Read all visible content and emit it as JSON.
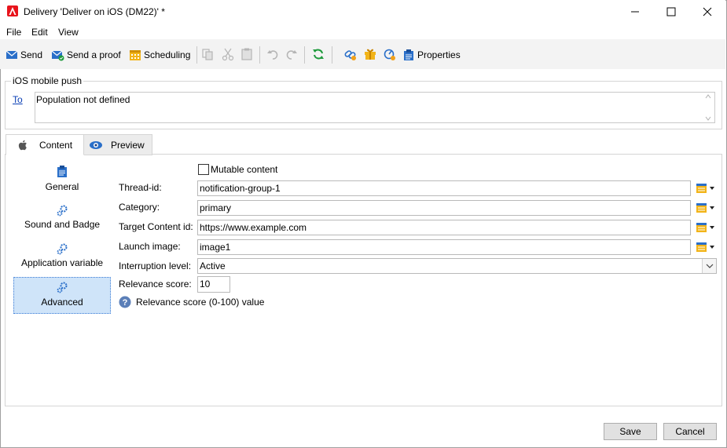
{
  "window": {
    "title": "Delivery 'Deliver on iOS (DM22)' *"
  },
  "menu": {
    "items": [
      "File",
      "Edit",
      "View"
    ]
  },
  "toolbar": {
    "send_label": "Send",
    "proof_label": "Send a proof",
    "scheduling_label": "Scheduling",
    "properties_label": "Properties"
  },
  "recipients": {
    "group_title": "iOS mobile push",
    "to_label": "To",
    "to_value": "Population not defined"
  },
  "tabs": [
    {
      "label": "Content",
      "active": true
    },
    {
      "label": "Preview",
      "active": false
    }
  ],
  "nav": {
    "items": [
      {
        "label": "General",
        "icon": "clipboard-icon",
        "selected": false
      },
      {
        "label": "Sound and Badge",
        "icon": "gears-icon",
        "selected": false
      },
      {
        "label": "Application variable",
        "icon": "gears-icon",
        "selected": false
      },
      {
        "label": "Advanced",
        "icon": "gears-icon",
        "selected": true
      }
    ]
  },
  "form": {
    "mutable_label": "Mutable content",
    "mutable_checked": false,
    "thread_label": "Thread-id:",
    "thread_value": "notification-group-1",
    "category_label": "Category:",
    "category_value": "primary",
    "target_label": "Target Content id:",
    "target_value": "https://www.example.com",
    "launch_label": "Launch image:",
    "launch_value": "image1",
    "interruption_label": "Interruption level:",
    "interruption_value": "Active",
    "relevance_label": "Relevance score:",
    "relevance_value": "10",
    "help_text": "Relevance score (0-100) value"
  },
  "footer": {
    "save_label": "Save",
    "cancel_label": "Cancel"
  },
  "colors": {
    "accent": "#0a3fb5",
    "selected_bg": "#cfe4f9",
    "app_icon": "#e8141c"
  }
}
